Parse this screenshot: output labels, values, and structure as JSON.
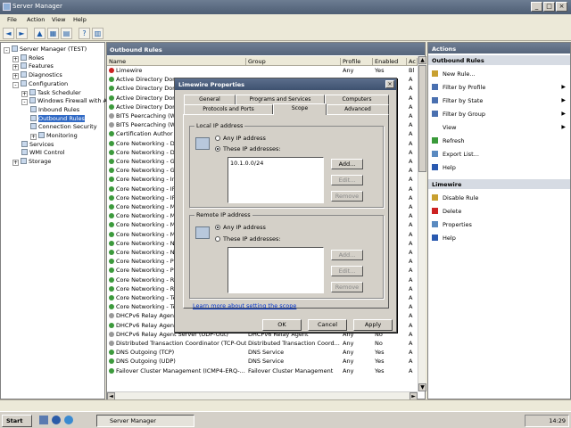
{
  "window": {
    "title": "Server Manager"
  },
  "menu": [
    "File",
    "Action",
    "View",
    "Help"
  ],
  "tree": [
    {
      "label": "Server Manager (TEST)",
      "indent": 0,
      "exp": "-"
    },
    {
      "label": "Roles",
      "indent": 1,
      "exp": "+"
    },
    {
      "label": "Features",
      "indent": 1,
      "exp": "+"
    },
    {
      "label": "Diagnostics",
      "indent": 1,
      "exp": "+"
    },
    {
      "label": "Configuration",
      "indent": 1,
      "exp": "-"
    },
    {
      "label": "Task Scheduler",
      "indent": 2,
      "exp": "+"
    },
    {
      "label": "Windows Firewall with A",
      "indent": 2,
      "exp": "-"
    },
    {
      "label": "Inbound Rules",
      "indent": 3,
      "exp": ""
    },
    {
      "label": "Outbound Rules",
      "indent": 3,
      "exp": "",
      "selected": true
    },
    {
      "label": "Connection Security",
      "indent": 3,
      "exp": ""
    },
    {
      "label": "Monitoring",
      "indent": 3,
      "exp": "+"
    },
    {
      "label": "Services",
      "indent": 2,
      "exp": ""
    },
    {
      "label": "WMI Control",
      "indent": 2,
      "exp": ""
    },
    {
      "label": "Storage",
      "indent": 1,
      "exp": "+"
    }
  ],
  "center": {
    "header": "Outbound Rules",
    "columns": [
      "Name",
      "Group",
      "Profile",
      "Enabled",
      "Ac"
    ],
    "rows": [
      {
        "name": "Limewire",
        "group": "",
        "profile": "Any",
        "enabled": "Yes",
        "ac": "Bl",
        "blocked": true
      },
      {
        "name": "Active Directory Dom",
        "group": "",
        "profile": "",
        "enabled": "",
        "ac": "A"
      },
      {
        "name": "Active Directory Dom",
        "group": "",
        "profile": "",
        "enabled": "",
        "ac": "A"
      },
      {
        "name": "Active Directory Dom",
        "group": "",
        "profile": "",
        "enabled": "",
        "ac": "A"
      },
      {
        "name": "Active Directory Dom",
        "group": "",
        "profile": "",
        "enabled": "",
        "ac": "A"
      },
      {
        "name": "BITS Peercaching (W",
        "group": "",
        "profile": "",
        "enabled": "",
        "ac": "A",
        "grey": true
      },
      {
        "name": "BITS Peercaching (W",
        "group": "",
        "profile": "",
        "enabled": "",
        "ac": "A",
        "grey": true
      },
      {
        "name": "Certification Author",
        "group": "",
        "profile": "",
        "enabled": "",
        "ac": "A"
      },
      {
        "name": "Core Networking - D",
        "group": "",
        "profile": "",
        "enabled": "",
        "ac": "A"
      },
      {
        "name": "Core Networking - D",
        "group": "",
        "profile": "",
        "enabled": "",
        "ac": "A"
      },
      {
        "name": "Core Networking - G",
        "group": "",
        "profile": "",
        "enabled": "",
        "ac": "A"
      },
      {
        "name": "Core Networking - G",
        "group": "",
        "profile": "",
        "enabled": "",
        "ac": "A"
      },
      {
        "name": "Core Networking - In",
        "group": "",
        "profile": "",
        "enabled": "",
        "ac": "A"
      },
      {
        "name": "Core Networking - IP",
        "group": "",
        "profile": "",
        "enabled": "",
        "ac": "A"
      },
      {
        "name": "Core Networking - IP",
        "group": "",
        "profile": "",
        "enabled": "",
        "ac": "A"
      },
      {
        "name": "Core Networking - M",
        "group": "",
        "profile": "",
        "enabled": "",
        "ac": "A"
      },
      {
        "name": "Core Networking - M",
        "group": "",
        "profile": "",
        "enabled": "",
        "ac": "A"
      },
      {
        "name": "Core Networking - M",
        "group": "",
        "profile": "",
        "enabled": "",
        "ac": "A"
      },
      {
        "name": "Core Networking - M",
        "group": "",
        "profile": "",
        "enabled": "",
        "ac": "A"
      },
      {
        "name": "Core Networking - N",
        "group": "",
        "profile": "",
        "enabled": "",
        "ac": "A"
      },
      {
        "name": "Core Networking - N",
        "group": "",
        "profile": "",
        "enabled": "",
        "ac": "A"
      },
      {
        "name": "Core Networking - P",
        "group": "",
        "profile": "",
        "enabled": "",
        "ac": "A"
      },
      {
        "name": "Core Networking - P",
        "group": "",
        "profile": "",
        "enabled": "",
        "ac": "A"
      },
      {
        "name": "Core Networking - R",
        "group": "",
        "profile": "",
        "enabled": "",
        "ac": "A"
      },
      {
        "name": "Core Networking - R",
        "group": "",
        "profile": "",
        "enabled": "",
        "ac": "A"
      },
      {
        "name": "Core Networking - Te",
        "group": "",
        "profile": "",
        "enabled": "",
        "ac": "A"
      },
      {
        "name": "Core Networking - Te",
        "group": "",
        "profile": "",
        "enabled": "",
        "ac": "A"
      },
      {
        "name": "DHCPv6 Relay Agent",
        "group": "",
        "profile": "",
        "enabled": "",
        "ac": "A",
        "grey": true
      },
      {
        "name": "DHCPv6 Relay Agent (ICMP-Out)",
        "group": "DHCPv6 Relay Agent",
        "profile": "Private",
        "enabled": "Yes",
        "ac": "A"
      },
      {
        "name": "DHCPv6 Relay Agent Server (UDP-Out)",
        "group": "DHCPv6 Relay Agent",
        "profile": "Any",
        "enabled": "No",
        "ac": "A",
        "grey": true
      },
      {
        "name": "Distributed Transaction Coordinator (TCP-Out)",
        "group": "Distributed Transaction Coord...",
        "profile": "Any",
        "enabled": "No",
        "ac": "A",
        "grey": true
      },
      {
        "name": "DNS Outgoing (TCP)",
        "group": "DNS Service",
        "profile": "Any",
        "enabled": "Yes",
        "ac": "A"
      },
      {
        "name": "DNS Outgoing (UDP)",
        "group": "DNS Service",
        "profile": "Any",
        "enabled": "Yes",
        "ac": "A"
      },
      {
        "name": "Failover Cluster Management (ICMP4-ERQ-...",
        "group": "Failover Cluster Management",
        "profile": "Any",
        "enabled": "Yes",
        "ac": "A"
      }
    ]
  },
  "actions": {
    "header": "Actions",
    "section1": "Outbound Rules",
    "items1": [
      {
        "label": "New Rule...",
        "arrow": false
      },
      {
        "label": "Filter by Profile",
        "arrow": true
      },
      {
        "label": "Filter by State",
        "arrow": true
      },
      {
        "label": "Filter by Group",
        "arrow": true
      },
      {
        "label": "View",
        "arrow": true
      },
      {
        "label": "Refresh",
        "arrow": false
      },
      {
        "label": "Export List...",
        "arrow": false
      },
      {
        "label": "Help",
        "arrow": false
      }
    ],
    "section2": "Limewire",
    "items2": [
      {
        "label": "Disable Rule"
      },
      {
        "label": "Delete"
      },
      {
        "label": "Properties"
      },
      {
        "label": "Help"
      }
    ]
  },
  "dialog": {
    "title": "Limewire Properties",
    "tabs_top": [
      "General",
      "Programs and Services",
      "Computers"
    ],
    "tabs_bottom": [
      "Protocols and Ports",
      "Scope",
      "Advanced"
    ],
    "local": {
      "label": "Local IP address",
      "opt_any": "Any IP address",
      "opt_these": "These IP addresses:",
      "ip": "10.1.0.0/24"
    },
    "remote": {
      "label": "Remote IP address",
      "opt_any": "Any IP address",
      "opt_these": "These IP addresses:"
    },
    "btn_add": "Add...",
    "btn_edit": "Edit...",
    "btn_remove": "Remove",
    "link": "Learn more about setting the scope",
    "ok": "OK",
    "cancel": "Cancel",
    "apply": "Apply"
  },
  "taskbar": {
    "start": "Start",
    "task": "Server Manager",
    "clock": "14:29"
  }
}
